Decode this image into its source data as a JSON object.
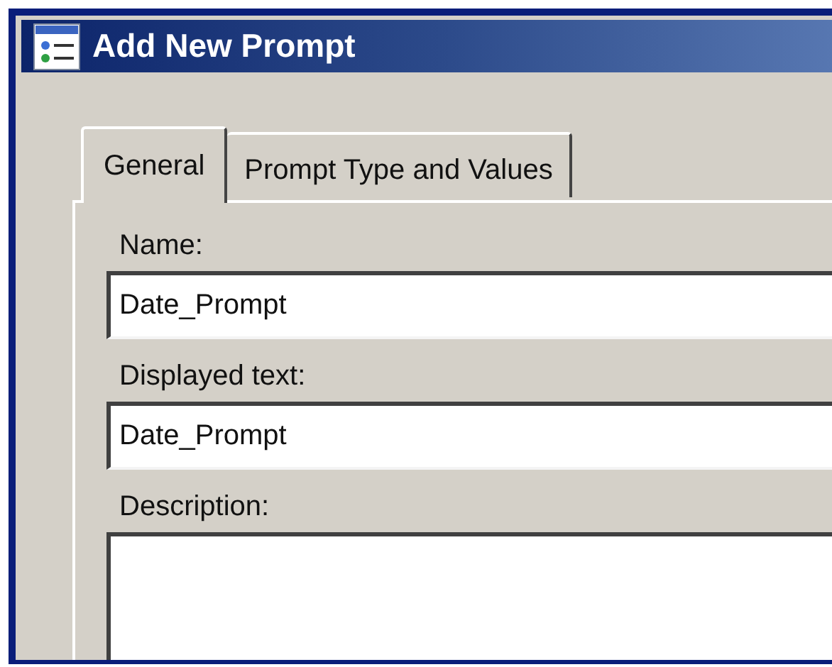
{
  "window": {
    "title": "Add New Prompt"
  },
  "tabs": [
    {
      "label": "General",
      "selected": true
    },
    {
      "label": "Prompt Type and Values",
      "selected": false
    }
  ],
  "fields": [
    {
      "kind": "line",
      "label": "Name:",
      "value": "Date_Prompt"
    },
    {
      "kind": "line",
      "label": "Displayed text:",
      "value": "Date_Prompt"
    },
    {
      "kind": "area",
      "label": "Description:"
    }
  ]
}
